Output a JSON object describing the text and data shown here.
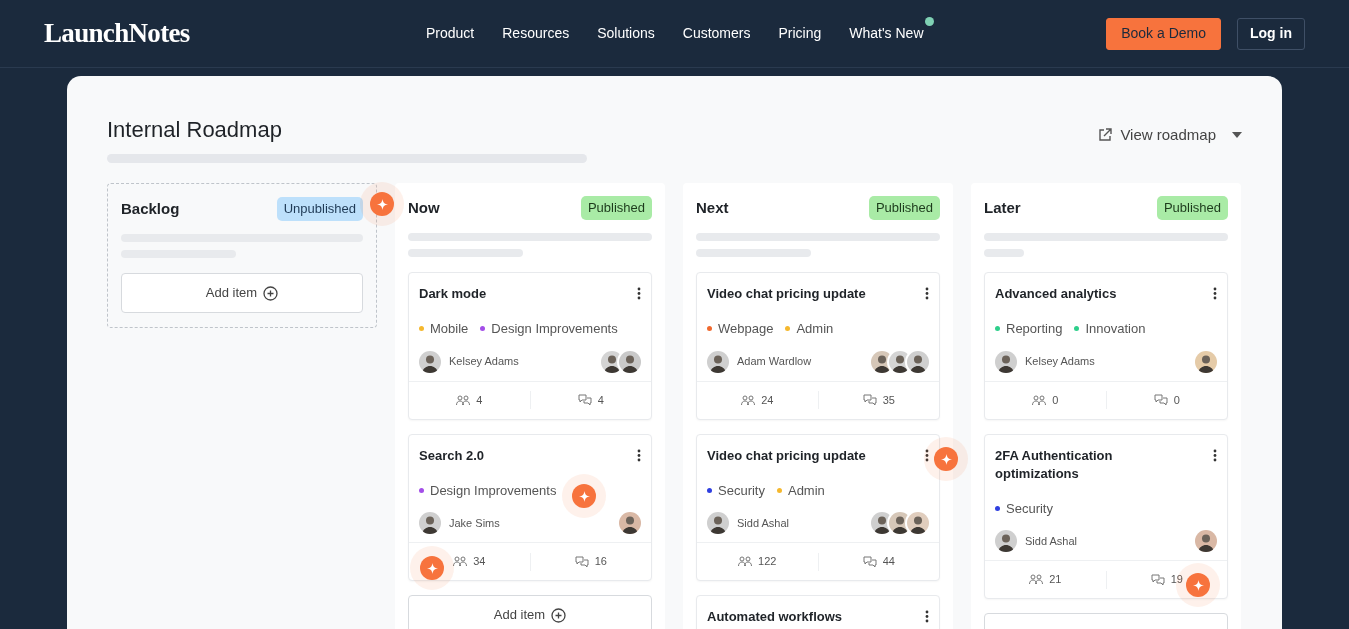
{
  "nav": {
    "logo": "LaunchNotes",
    "links": [
      {
        "label": "Product",
        "badge": false
      },
      {
        "label": "Resources",
        "badge": false
      },
      {
        "label": "Solutions",
        "badge": false
      },
      {
        "label": "Customers",
        "badge": false
      },
      {
        "label": "Pricing",
        "badge": false
      },
      {
        "label": "What's New",
        "badge": true
      }
    ],
    "demo_button": "Book a Demo",
    "login_button": "Log in"
  },
  "roadmap": {
    "title": "Internal Roadmap",
    "view_button": "View roadmap"
  },
  "columns": [
    {
      "title": "Backlog",
      "status": "Unpublished",
      "kind": "draft",
      "add_item": "Add item"
    },
    {
      "title": "Now",
      "status": "Published",
      "kind": "published",
      "add_item": "Add item",
      "cards": [
        {
          "title": "Dark mode",
          "tags": [
            {
              "label": "Mobile",
              "color": "#f5b82e"
            },
            {
              "label": "Design Improvements",
              "color": "#a34ee8"
            }
          ],
          "owner": "Kelsey Adams",
          "watchers": [
            {
              "color": "#d4d4d4"
            },
            {
              "color": "#c9c9c9"
            }
          ],
          "votes": "4",
          "comments": "4"
        },
        {
          "title": "Search 2.0",
          "tags": [
            {
              "label": "Design Improvements",
              "color": "#a34ee8"
            }
          ],
          "owner": "Jake Sims",
          "watchers": [
            {
              "color": "#d9b8a5"
            }
          ],
          "votes": "34",
          "comments": "16"
        }
      ]
    },
    {
      "title": "Next",
      "status": "Published",
      "kind": "published",
      "cards": [
        {
          "title": "Video chat pricing update",
          "tags": [
            {
              "label": "Webpage",
              "color": "#f0692e"
            },
            {
              "label": "Admin",
              "color": "#f5b82e"
            }
          ],
          "owner": "Adam Wardlow",
          "watchers": [
            {
              "color": "#d6c7b8"
            },
            {
              "color": "#d4d4d4"
            },
            {
              "color": "#cfcfcf"
            }
          ],
          "votes": "24",
          "comments": "35"
        },
        {
          "title": "Video chat pricing update",
          "tags": [
            {
              "label": "Security",
              "color": "#2f3fe0"
            },
            {
              "label": "Admin",
              "color": "#f5b82e"
            }
          ],
          "owner": "Sidd Ashal",
          "watchers": [
            {
              "color": "#cfcfcf"
            },
            {
              "color": "#d6c7b8"
            },
            {
              "color": "#e0cdbd"
            }
          ],
          "votes": "122",
          "comments": "44"
        },
        {
          "title": "Automated workflows"
        }
      ]
    },
    {
      "title": "Later",
      "status": "Published",
      "kind": "published",
      "add_blank": true,
      "cards": [
        {
          "title": "Advanced analytics",
          "tags": [
            {
              "label": "Reporting",
              "color": "#2ecf8b"
            },
            {
              "label": "Innovation",
              "color": "#2ecf8b"
            }
          ],
          "owner": "Kelsey Adams",
          "watchers": [
            {
              "color": "#e5cba8"
            }
          ],
          "votes": "0",
          "comments": "0"
        },
        {
          "title": "2FA Authentication optimizations",
          "tags": [
            {
              "label": "Security",
              "color": "#2f3fe0"
            }
          ],
          "owner": "Sidd Ashal",
          "watchers": [
            {
              "color": "#d9b8a5"
            }
          ],
          "votes": "21",
          "comments": "19"
        }
      ]
    }
  ]
}
